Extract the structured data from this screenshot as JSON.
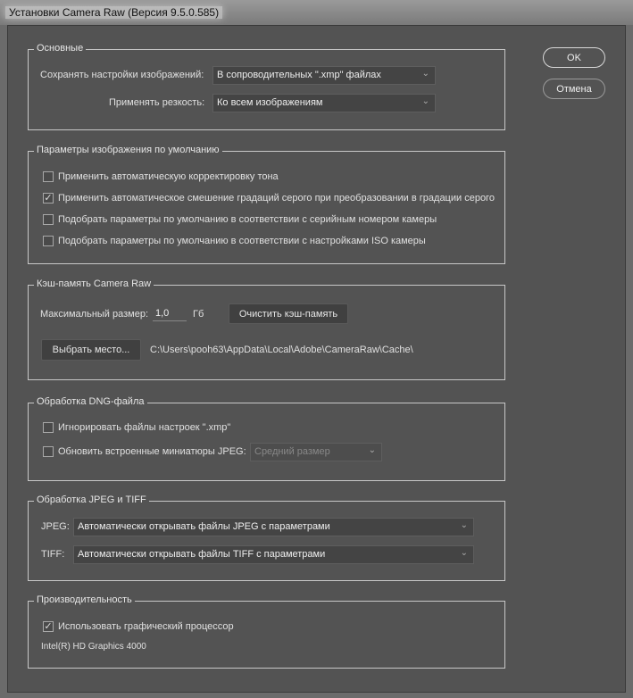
{
  "window_title": "Установки Camera Raw  (Версия 9.5.0.585)",
  "buttons": {
    "ok": "OK",
    "cancel": "Отмена"
  },
  "general": {
    "title": "Основные",
    "save_label": "Сохранять настройки изображений:",
    "save_value": "В сопроводительных \".xmp\" файлах",
    "sharpen_label": "Применять резкость:",
    "sharpen_value": "Ко всем изображениям"
  },
  "defaults": {
    "title": "Параметры изображения по умолчанию",
    "items": [
      {
        "label": "Применить автоматическую корректировку тона",
        "checked": false
      },
      {
        "label": "Применить автоматическое смешение градаций серого при преобразовании в градации серого",
        "checked": true
      },
      {
        "label": "Подобрать параметры по умолчанию в соответствии с серийным номером камеры",
        "checked": false
      },
      {
        "label": "Подобрать параметры по умолчанию в соответствии с настройками ISO камеры",
        "checked": false
      }
    ]
  },
  "cache": {
    "title": "Кэш-память Camera Raw",
    "max_label": "Максимальный размер:",
    "max_value": "1,0",
    "unit": "Гб",
    "purge": "Очистить кэш-память",
    "select_location": "Выбрать место...",
    "path": "C:\\Users\\pooh63\\AppData\\Local\\Adobe\\CameraRaw\\Cache\\"
  },
  "dng": {
    "title": "Обработка DNG-файла",
    "ignore_label": "Игнорировать файлы настроек \".xmp\"",
    "ignore_checked": false,
    "update_label": "Обновить встроенные миниатюры JPEG:",
    "update_checked": false,
    "size_value": "Средний размер"
  },
  "jpeg_tiff": {
    "title": "Обработка JPEG и TIFF",
    "jpeg_label": "JPEG:",
    "jpeg_value": "Автоматически открывать файлы JPEG с параметрами",
    "tiff_label": "TIFF:",
    "tiff_value": "Автоматически открывать файлы TIFF с параметрами"
  },
  "performance": {
    "title": "Производительность",
    "gpu_label": "Использовать графический процессор",
    "gpu_checked": true,
    "gpu_name": "Intel(R) HD Graphics 4000"
  },
  "icons": {
    "chevron": "⌄",
    "check": "✓"
  }
}
